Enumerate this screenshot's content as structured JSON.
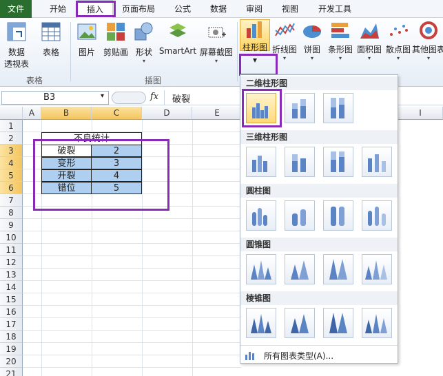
{
  "tabs": [
    "文件",
    "开始",
    "插入",
    "页面布局",
    "公式",
    "数据",
    "审阅",
    "视图",
    "开发工具"
  ],
  "ribbon": {
    "pivot_label_1": "数据",
    "pivot_label_2": "透视表",
    "table_label": "表格",
    "picture_label": "图片",
    "clipart_label": "剪贴画",
    "shape_label": "形状",
    "smartart_label": "SmartArt",
    "screenshot_label": "屏幕截图",
    "column_label": "柱形图",
    "line_label": "折线图",
    "pie_label": "饼图",
    "bar_label": "条形图",
    "area_label": "面积图",
    "scatter_label": "散点图",
    "other_label": "其他图表",
    "group_tables": "表格",
    "group_illustrations": "插图"
  },
  "formula_bar": {
    "name_box": "B3",
    "fx": "fx",
    "formula": "破裂"
  },
  "grid": {
    "columns": [
      "A",
      "B",
      "C",
      "D",
      "E",
      "I"
    ],
    "rows": [
      "1",
      "2",
      "3",
      "4",
      "5",
      "6",
      "7",
      "8",
      "9",
      "10",
      "11",
      "12",
      "13",
      "14",
      "15",
      "16",
      "17",
      "18",
      "19",
      "20",
      "21"
    ],
    "table_title": "不良统计",
    "items": [
      {
        "name": "破裂",
        "count": "2"
      },
      {
        "name": "变形",
        "count": "3"
      },
      {
        "name": "开裂",
        "count": "4"
      },
      {
        "name": "错位",
        "count": "5"
      }
    ]
  },
  "dropdown": {
    "sec_2d": "二维柱形图",
    "sec_3d": "三维柱形图",
    "sec_cylinder": "圆柱图",
    "sec_cone": "圆锥图",
    "sec_pyramid": "棱锥图",
    "all_types": "所有图表类型(A)..."
  },
  "colors": {
    "accent_purple": "#8a2bb8",
    "file_tab": "#2a6e2f",
    "highlight": "#aecff0"
  }
}
